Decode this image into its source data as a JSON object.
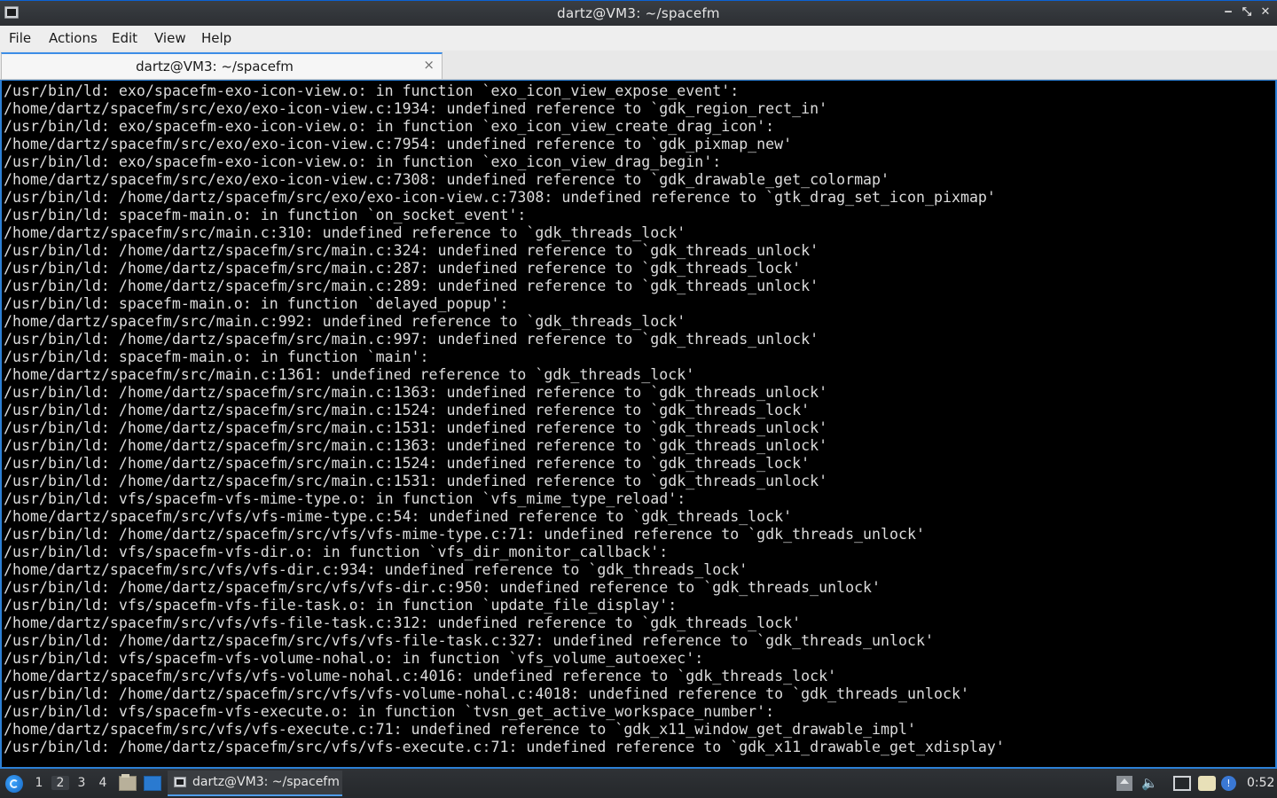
{
  "window": {
    "title": "dartz@VM3: ~/spacefm",
    "app_icon": "terminal-icon",
    "controls": [
      "minimize-icon",
      "maximize-icon",
      "close-icon"
    ]
  },
  "menubar": {
    "items": [
      "File",
      "Actions",
      "Edit",
      "View",
      "Help"
    ]
  },
  "tabs": [
    {
      "label": "dartz@VM3: ~/spacefm",
      "close": "×"
    }
  ],
  "terminal": {
    "background": "#000000",
    "foreground": "#dcdcdc",
    "lines": [
      "/usr/bin/ld: exo/spacefm-exo-icon-view.o: in function `exo_icon_view_expose_event':",
      "/home/dartz/spacefm/src/exo/exo-icon-view.c:1934: undefined reference to `gdk_region_rect_in'",
      "/usr/bin/ld: exo/spacefm-exo-icon-view.o: in function `exo_icon_view_create_drag_icon':",
      "/home/dartz/spacefm/src/exo/exo-icon-view.c:7954: undefined reference to `gdk_pixmap_new'",
      "/usr/bin/ld: exo/spacefm-exo-icon-view.o: in function `exo_icon_view_drag_begin':",
      "/home/dartz/spacefm/src/exo/exo-icon-view.c:7308: undefined reference to `gdk_drawable_get_colormap'",
      "/usr/bin/ld: /home/dartz/spacefm/src/exo/exo-icon-view.c:7308: undefined reference to `gtk_drag_set_icon_pixmap'",
      "/usr/bin/ld: spacefm-main.o: in function `on_socket_event':",
      "/home/dartz/spacefm/src/main.c:310: undefined reference to `gdk_threads_lock'",
      "/usr/bin/ld: /home/dartz/spacefm/src/main.c:324: undefined reference to `gdk_threads_unlock'",
      "/usr/bin/ld: /home/dartz/spacefm/src/main.c:287: undefined reference to `gdk_threads_lock'",
      "/usr/bin/ld: /home/dartz/spacefm/src/main.c:289: undefined reference to `gdk_threads_unlock'",
      "/usr/bin/ld: spacefm-main.o: in function `delayed_popup':",
      "/home/dartz/spacefm/src/main.c:992: undefined reference to `gdk_threads_lock'",
      "/usr/bin/ld: /home/dartz/spacefm/src/main.c:997: undefined reference to `gdk_threads_unlock'",
      "/usr/bin/ld: spacefm-main.o: in function `main':",
      "/home/dartz/spacefm/src/main.c:1361: undefined reference to `gdk_threads_lock'",
      "/usr/bin/ld: /home/dartz/spacefm/src/main.c:1363: undefined reference to `gdk_threads_unlock'",
      "/usr/bin/ld: /home/dartz/spacefm/src/main.c:1524: undefined reference to `gdk_threads_lock'",
      "/usr/bin/ld: /home/dartz/spacefm/src/main.c:1531: undefined reference to `gdk_threads_unlock'",
      "/usr/bin/ld: /home/dartz/spacefm/src/main.c:1363: undefined reference to `gdk_threads_unlock'",
      "/usr/bin/ld: /home/dartz/spacefm/src/main.c:1524: undefined reference to `gdk_threads_lock'",
      "/usr/bin/ld: /home/dartz/spacefm/src/main.c:1531: undefined reference to `gdk_threads_unlock'",
      "/usr/bin/ld: vfs/spacefm-vfs-mime-type.o: in function `vfs_mime_type_reload':",
      "/home/dartz/spacefm/src/vfs/vfs-mime-type.c:54: undefined reference to `gdk_threads_lock'",
      "/usr/bin/ld: /home/dartz/spacefm/src/vfs/vfs-mime-type.c:71: undefined reference to `gdk_threads_unlock'",
      "/usr/bin/ld: vfs/spacefm-vfs-dir.o: in function `vfs_dir_monitor_callback':",
      "/home/dartz/spacefm/src/vfs/vfs-dir.c:934: undefined reference to `gdk_threads_lock'",
      "/usr/bin/ld: /home/dartz/spacefm/src/vfs/vfs-dir.c:950: undefined reference to `gdk_threads_unlock'",
      "/usr/bin/ld: vfs/spacefm-vfs-file-task.o: in function `update_file_display':",
      "/home/dartz/spacefm/src/vfs/vfs-file-task.c:312: undefined reference to `gdk_threads_lock'",
      "/usr/bin/ld: /home/dartz/spacefm/src/vfs/vfs-file-task.c:327: undefined reference to `gdk_threads_unlock'",
      "/usr/bin/ld: vfs/spacefm-vfs-volume-nohal.o: in function `vfs_volume_autoexec':",
      "/home/dartz/spacefm/src/vfs/vfs-volume-nohal.c:4016: undefined reference to `gdk_threads_lock'",
      "/usr/bin/ld: /home/dartz/spacefm/src/vfs/vfs-volume-nohal.c:4018: undefined reference to `gdk_threads_unlock'",
      "/usr/bin/ld: vfs/spacefm-vfs-execute.o: in function `tvsn_get_active_workspace_number':",
      "/home/dartz/spacefm/src/vfs/vfs-execute.c:71: undefined reference to `gdk_x11_window_get_drawable_impl'",
      "/usr/bin/ld: /home/dartz/spacefm/src/vfs/vfs-execute.c:71: undefined reference to `gdk_x11_drawable_get_xdisplay'"
    ]
  },
  "taskbar": {
    "start_icon": "lxqt-menu-icon",
    "workspaces": [
      "1",
      "2",
      "3",
      "4"
    ],
    "active_workspace": "2",
    "quicklaunch": [
      "file-manager-icon",
      "show-desktop-icon"
    ],
    "tasks": [
      {
        "label": "dartz@VM3: ~/spacefm",
        "icon": "terminal-icon"
      }
    ],
    "tray": [
      "eject-icon",
      "volume-icon",
      "network-icon",
      "clipboard-icon",
      "update-notifier-icon"
    ],
    "clock": "0:52"
  },
  "colors": {
    "accent": "#2c80d6",
    "titlebar": "#2c2f33",
    "menubar": "#eeeeee",
    "taskbar": "#25282b"
  }
}
